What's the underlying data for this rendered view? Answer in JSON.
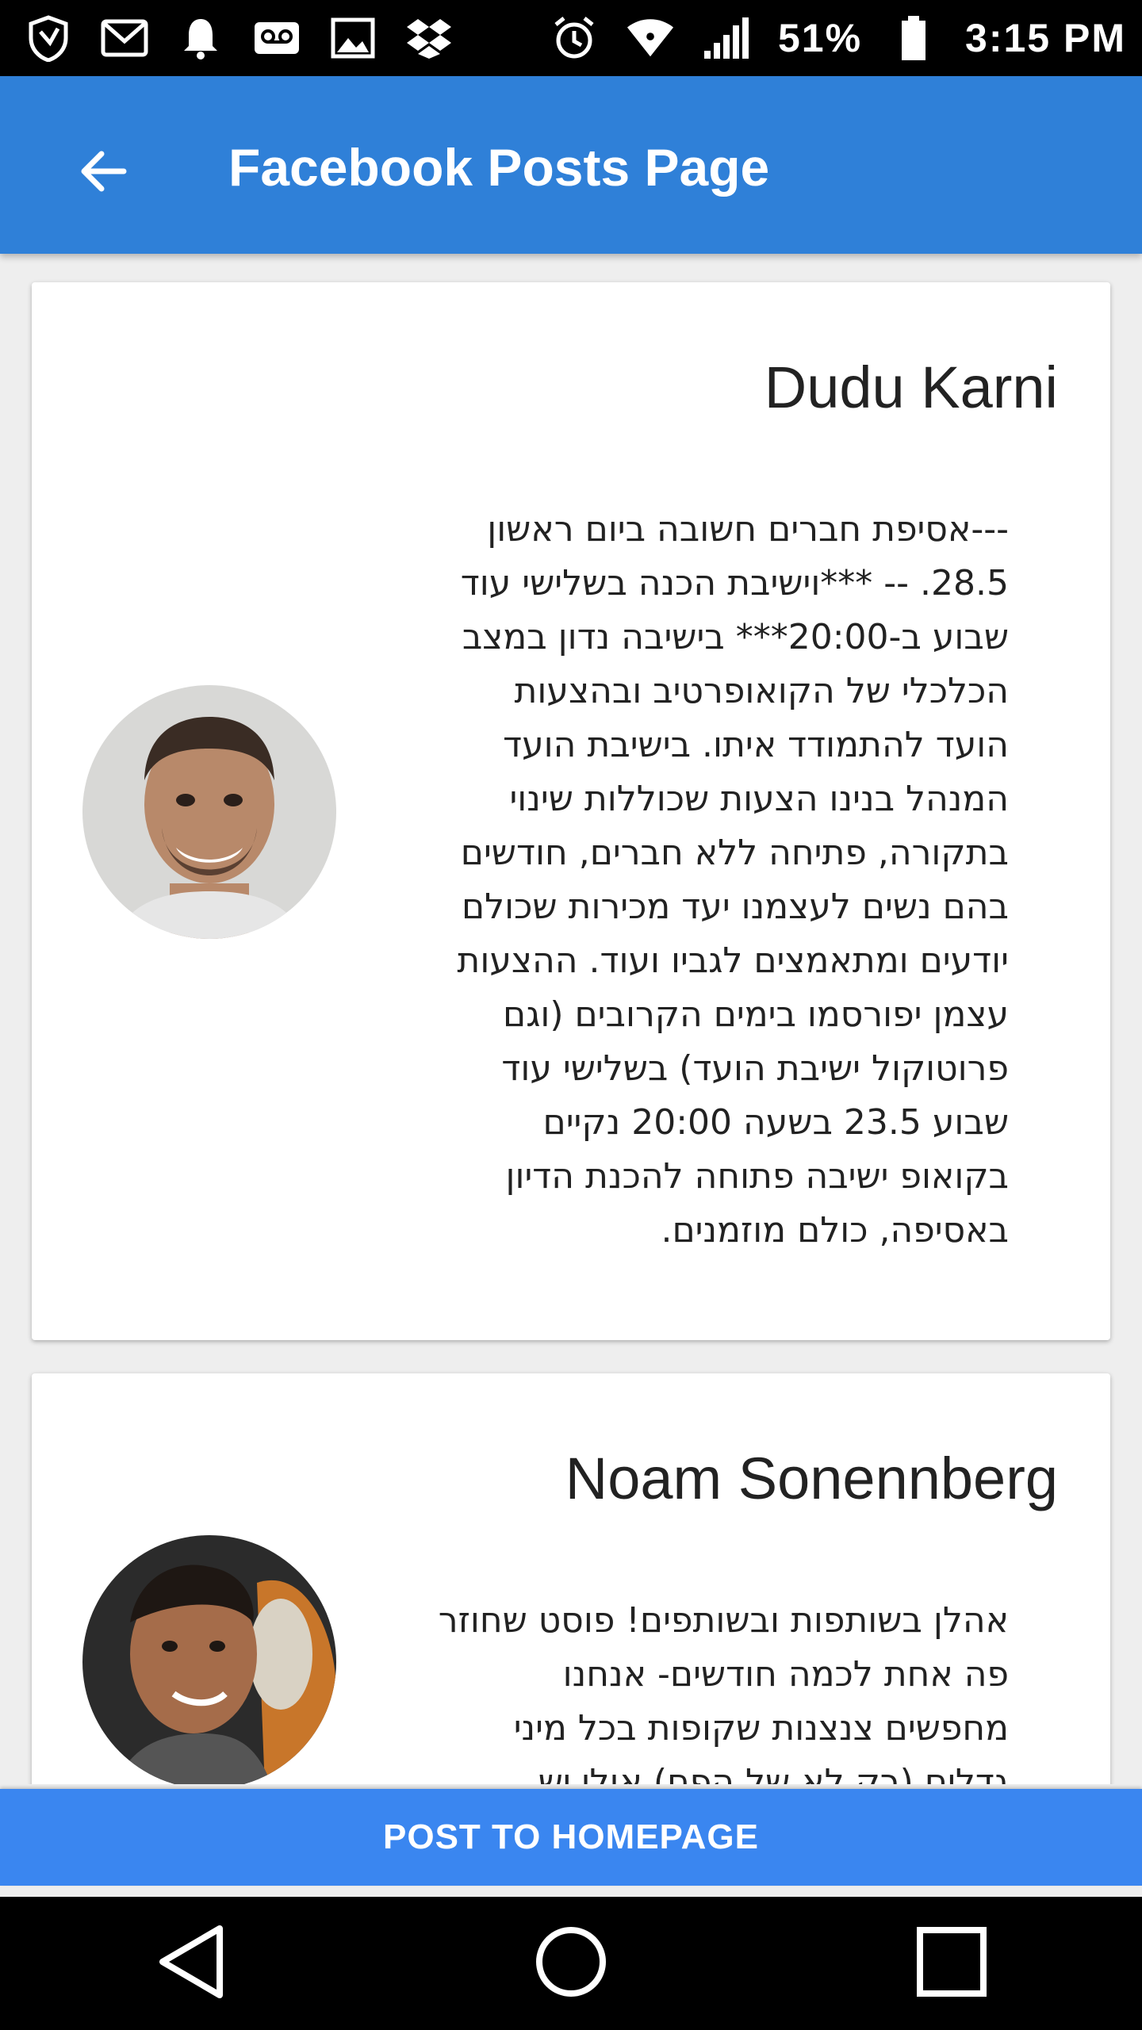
{
  "status_bar": {
    "battery": "51%",
    "time": "3:15 PM",
    "left_icons": [
      "shield-notification-icon",
      "gmail-icon",
      "bell-icon",
      "voicemail-icon",
      "image-icon",
      "dropbox-icon"
    ],
    "right_icons": [
      "alarm-icon",
      "wifi-icon",
      "signal-icon",
      "battery-icon"
    ]
  },
  "app_bar": {
    "title": "Facebook Posts Page",
    "back_icon": "arrow-left-icon",
    "color": "#2f80d8"
  },
  "posts": [
    {
      "author": "Dudu Karni",
      "body": "---אסיפת חברים חשובה ביום ראשון 28.5. -- ***וישיבת הכנה בשלישי עוד שבוע ב-20:00*** בישיבה נדון במצב הכלכלי של הקואופרטיב ובהצעות הועד להתמודד איתו. בישיבת הועד המנהל בנינו הצעות שכוללות שינוי בתקורה, פתיחה ללא חברים, חודשים בהם נשים לעצמנו יעד מכירות שכולם יודעים ומתאמצים לגביו ועוד. ההצעות עצמן יפורסמו בימים הקרובים (וגם פרוטוקול ישיבת הועד) בשלישי עוד שבוע 23.5 בשעה 20:00 נקיים בקואופ ישיבה פתוחה להכנת הדיון באסיפה, כולם מוזמנים."
    },
    {
      "author": "Noam Sonennberg",
      "body": "אהלן בשותפות ובשותפים! פוסט שחוזר פה אחת לכמה חודשים- אנחנו מחפשים צנצנות שקופות בכל מיני גדלים (רק לא של הפח) אולי יש"
    }
  ],
  "bottom_button": {
    "label": "POST TO HOMEPAGE",
    "color": "#3a86f0"
  },
  "nav_bar": {
    "icons": [
      "back-triangle-icon",
      "home-circle-icon",
      "recents-square-icon"
    ]
  }
}
